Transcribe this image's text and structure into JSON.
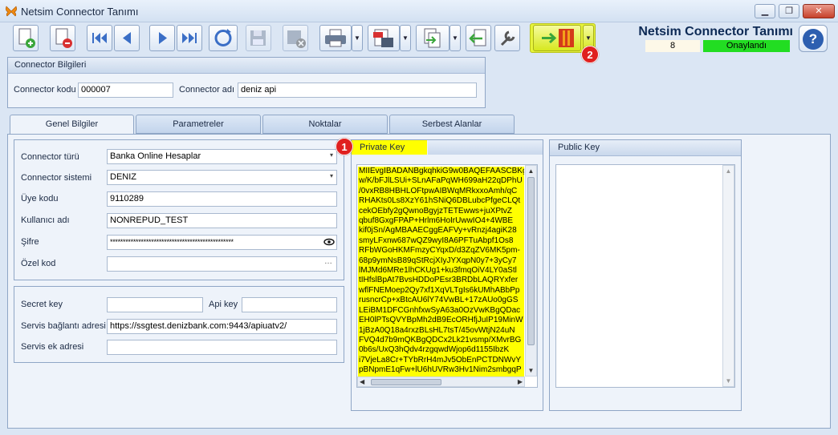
{
  "window": {
    "title": "Netsim Connector Tanımı",
    "min": "▁",
    "restore": "❐",
    "close": "✕"
  },
  "header": {
    "title": "Netsim Connector Tanımı",
    "count": "8",
    "status": "Onaylandı",
    "status_color": "#22dd22",
    "help": "?"
  },
  "badges": {
    "one": "1",
    "two": "2"
  },
  "toolbar": {
    "icons": [
      "new-document-icon",
      "delete-document-icon",
      "first-record-icon",
      "previous-record-icon",
      "next-record-icon",
      "last-record-icon",
      "refresh-icon",
      "save-disabled-icon",
      "cancel-disabled-icon",
      "print-icon",
      "pdf-export-icon",
      "export-icon",
      "import-icon",
      "settings-wrench-icon",
      "exit-icon"
    ]
  },
  "connector": {
    "section_title": "Connector Bilgileri",
    "code_label": "Connector kodu",
    "code_value": "000007",
    "name_label": "Connector adı",
    "name_value": "deniz api"
  },
  "tabs": [
    "Genel Bilgiler",
    "Parametreler",
    "Noktalar",
    "Serbest Alanlar"
  ],
  "form": {
    "type_label": "Connector türü",
    "type_value": "Banka Online Hesaplar",
    "system_label": "Connector sistemi",
    "system_value": "DENIZ",
    "member_label": "Üye kodu",
    "member_value": "9110289",
    "user_label": "Kullanıcı adı",
    "user_value": "NONREPUD_TEST",
    "password_label": "Şifre",
    "password_value": "************************************************",
    "special_label": "Özel kod",
    "special_value": "",
    "ellipsis": "…"
  },
  "form2": {
    "secret_label": "Secret key",
    "secret_value": "",
    "apikey_label": "Api key",
    "apikey_value": "",
    "url_label": "Servis bağlantı adresi",
    "url_value": "https://ssgtest.denizbank.com:9443/apiuatv2/",
    "extra_label": "Servis ek adresi",
    "extra_value": ""
  },
  "private_key": {
    "title": "Private Key",
    "highlight_color": "#ffff00",
    "lines": [
      "MIIEvgIBADANBgkqhkiG9w0BAQEFAASCBKgwggSk",
      "w/K/bFJlLSUi+SLnAFaPqWH699aH22qDPhU",
      "/0vxRB8HBHLOFtpwAIBWqMRkxxoAmh/qC",
      "RHAKts0Ls8XzY61hSNiQ6DBLubcPfgeCLQt",
      "cekOEbfy2gQwnoBgyjzTETEwws+juXPtvZ",
      "qbuf8GxgFPAP+Hrlm6HoIrUwwIO4+4WBE",
      "kif0jSn/AgMBAAECggEAFVy+vRnzj4agiK28",
      "smyLFxnw687wQZ9wyI8A6PFTuAbpf1Os8",
      "RFbWGoHKMFmzyCYqxD/d3ZqZV6MK5pm-",
      "68p9ymNsB89qStRcjXIyJYXqpN0y7+3yCy7",
      "lMJMd6MRe1lhCKUg1+ku3fmqOiV4LY0aStl",
      "tIHfslBpAt7BvsHDDoPEsr3BRDbLAQRYxfer",
      "wflFNEMoep2Qy7xf1XqVLTgIs6kUMhABbPp",
      "rusncrCp+xBtcAU6lY74VwBL+17zAUo0gGS",
      "LEiBM1DFCGnhfxwSyA63a0OzVwKBgQDac",
      "EH0lPTsQVYBpMh2dB9EcORHfjJuIP19MinW",
      "1jBzA0Q18a4rxzBLsHL7tsT/45ovWtjN24uN",
      "FVQ4d7b9mQKBgQDCx2Lk21vsmp/XMvrBG",
      "0b6s/UxQ3hQdv4rzgqwdWjop6d1155IbzK",
      "i7VjeLa8Cr+TYbRrH4mJv5ObEnPCTDNWvY",
      "pBNpmE1qFw+lU6hUVRw3Hv1Nim2smbgqP"
    ]
  },
  "public_key": {
    "title": "Public Key",
    "lines": []
  }
}
